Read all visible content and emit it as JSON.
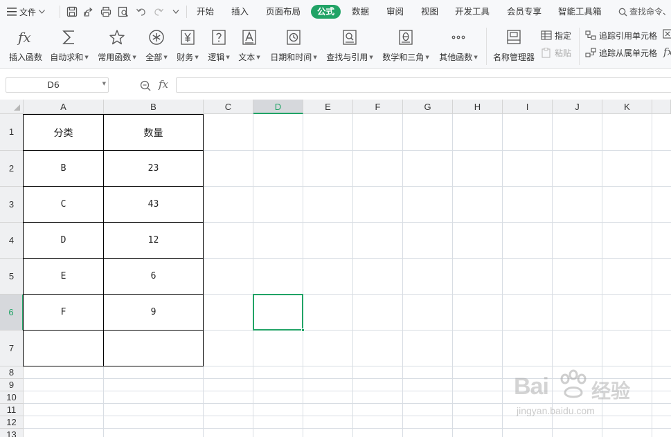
{
  "menu": {
    "file_label": "文件",
    "tabs": [
      "开始",
      "插入",
      "页面布局",
      "公式",
      "数据",
      "审阅",
      "视图",
      "开发工具",
      "会员专享",
      "智能工具箱"
    ],
    "active_tab": "公式",
    "search_label": "查找命令、"
  },
  "ribbon": {
    "buttons": [
      {
        "label": "插入函数",
        "icon": "fx-icon",
        "has_dropdown": false
      },
      {
        "label": "自动求和",
        "icon": "sigma-icon",
        "has_dropdown": true
      },
      {
        "label": "常用函数",
        "icon": "star-icon",
        "has_dropdown": true
      },
      {
        "label": "全部",
        "icon": "asterisk-circle-icon",
        "has_dropdown": true
      },
      {
        "label": "财务",
        "icon": "yen-icon",
        "has_dropdown": true
      },
      {
        "label": "逻辑",
        "icon": "question-box-icon",
        "has_dropdown": true
      },
      {
        "label": "文本",
        "icon": "text-a-icon",
        "has_dropdown": true
      },
      {
        "label": "日期和时间",
        "icon": "clock-icon",
        "has_dropdown": true
      },
      {
        "label": "查找与引用",
        "icon": "search-doc-icon",
        "has_dropdown": true
      },
      {
        "label": "数学和三角",
        "icon": "theta-icon",
        "has_dropdown": true
      },
      {
        "label": "其他函数",
        "icon": "more-dots-icon",
        "has_dropdown": true
      },
      {
        "label": "名称管理器",
        "icon": "name-manager-icon",
        "has_dropdown": false
      }
    ],
    "small_buttons": {
      "specify": "指定",
      "paste": "粘贴",
      "trace_precedents": "追踪引用单元格",
      "trace_dependents": "追踪从属单元格"
    }
  },
  "formula_bar": {
    "name_box": "D6",
    "fx_label": "fx",
    "value": ""
  },
  "sheet": {
    "columns": [
      "A",
      "B",
      "C",
      "D",
      "E",
      "F",
      "G",
      "H",
      "I",
      "J",
      "K"
    ],
    "rows": [
      "1",
      "2",
      "3",
      "4",
      "5",
      "6",
      "7",
      "8",
      "9",
      "10",
      "11",
      "12",
      "13"
    ],
    "selected_cell": "D6",
    "table": {
      "headers": [
        "分类",
        "数量"
      ],
      "rows": [
        [
          "B",
          "23"
        ],
        [
          "C",
          "43"
        ],
        [
          "D",
          "12"
        ],
        [
          "E",
          "6"
        ],
        [
          "F",
          "9"
        ],
        [
          "",
          ""
        ]
      ]
    }
  },
  "watermark": {
    "brand": "Bai",
    "brand2": "经验",
    "url": "jingyan.baidu.com"
  },
  "colors": {
    "accent": "#21a366",
    "ribbon_bg": "#f7f8fa",
    "header_bg": "#eff0f2",
    "gridline": "#d8dde3"
  }
}
